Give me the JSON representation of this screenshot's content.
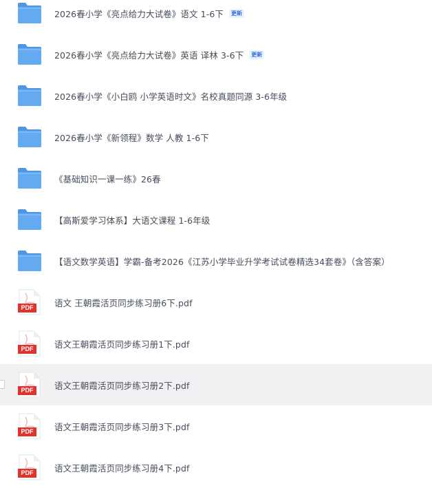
{
  "file_list": {
    "items": [
      {
        "type": "folder",
        "icon": "folder-icon",
        "name": "2026春小学《亮点给力大试卷》语文  1-6下",
        "badge": "更新"
      },
      {
        "type": "folder",
        "icon": "folder-icon",
        "name": "2026春小学《亮点给力大试卷》英语  译林  3-6下",
        "badge": "更新"
      },
      {
        "type": "folder",
        "icon": "folder-icon",
        "name": "2026春小学《小白鸥 小学英语时文》名校真题同源  3-6年级"
      },
      {
        "type": "folder",
        "icon": "folder-icon",
        "name": "2026春小学《新领程》数学 人教  1-6下"
      },
      {
        "type": "folder",
        "icon": "folder-icon",
        "name": "《基础知识一课一练》26春"
      },
      {
        "type": "folder",
        "icon": "folder-icon",
        "name": "【高斯爱学习体系】大语文课程  1-6年级"
      },
      {
        "type": "folder",
        "icon": "folder-icon",
        "name": "【语文数学英语】学霸-备考2026《江苏小学毕业升学考试试卷精选34套卷》（含答案）"
      },
      {
        "type": "pdf",
        "icon": "pdf-file-icon",
        "icon_label": "PDF",
        "name": "语文 王朝霞活页同步练习册6下.pdf"
      },
      {
        "type": "pdf",
        "icon": "pdf-file-icon",
        "icon_label": "PDF",
        "name": "语文王朝霞活页同步练习册1下.pdf"
      },
      {
        "type": "pdf",
        "icon": "pdf-file-icon",
        "icon_label": "PDF",
        "name": "语文王朝霞活页同步练习册2下.pdf",
        "hovered": true
      },
      {
        "type": "pdf",
        "icon": "pdf-file-icon",
        "icon_label": "PDF",
        "name": "语文王朝霞活页同步练习册3下.pdf"
      },
      {
        "type": "pdf",
        "icon": "pdf-file-icon",
        "icon_label": "PDF",
        "name": "语文王朝霞活页同步练习册4下.pdf"
      }
    ]
  },
  "colors": {
    "folder": "#64aaf1",
    "folder_back": "#4f96e4",
    "pdf_red": "#e0332f",
    "badge_text": "#2f6fdc",
    "badge_bg": "#eaf2ff",
    "row_hover": "#f1f1f3",
    "text": "#454d5a"
  }
}
